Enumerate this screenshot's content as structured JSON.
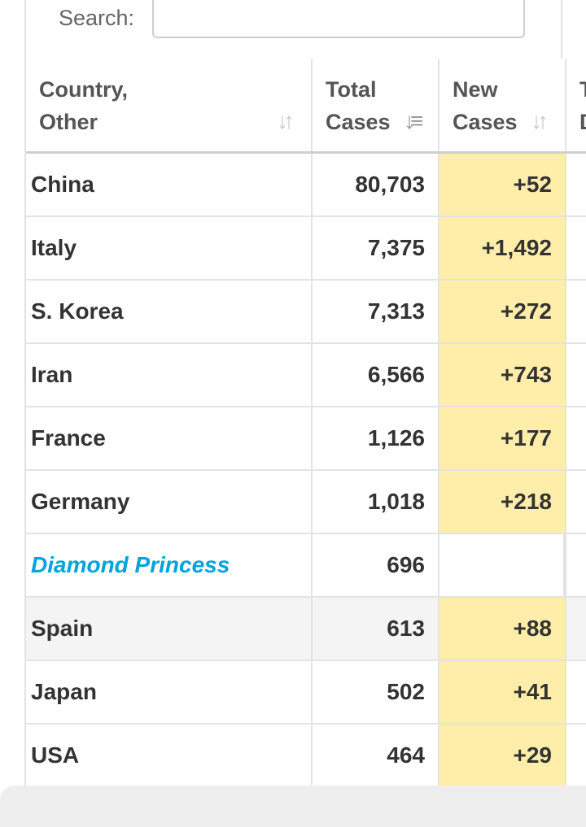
{
  "search": {
    "label": "Search:",
    "value": "",
    "placeholder": ""
  },
  "table": {
    "headers": {
      "country": [
        "Country,",
        "Other"
      ],
      "total_cases": [
        "Total",
        "Cases"
      ],
      "new_cases": [
        "New",
        "Cases"
      ],
      "next_partial": [
        "T",
        "D"
      ]
    },
    "sort_icons": {
      "country": "sort-unsorted-icon",
      "total_cases": "sort-descending-icon",
      "new_cases": "sort-unsorted-icon"
    },
    "rows": [
      {
        "country": "China",
        "total": "80,703",
        "new": "+52"
      },
      {
        "country": "Italy",
        "total": "7,375",
        "new": "+1,492"
      },
      {
        "country": "S. Korea",
        "total": "7,313",
        "new": "+272"
      },
      {
        "country": "Iran",
        "total": "6,566",
        "new": "+743"
      },
      {
        "country": "France",
        "total": "1,126",
        "new": "+177"
      },
      {
        "country": "Germany",
        "total": "1,018",
        "new": "+218"
      },
      {
        "country": "Diamond Princess",
        "total": "696",
        "new": ""
      },
      {
        "country": "Spain",
        "total": "613",
        "new": "+88"
      },
      {
        "country": "Japan",
        "total": "502",
        "new": "+41"
      },
      {
        "country": "USA",
        "total": "464",
        "new": "+29"
      }
    ]
  },
  "colors": {
    "new_cases_highlight": "#ffeeaa",
    "link": "#00a3de",
    "text": "#333333",
    "header_text": "#555555"
  }
}
